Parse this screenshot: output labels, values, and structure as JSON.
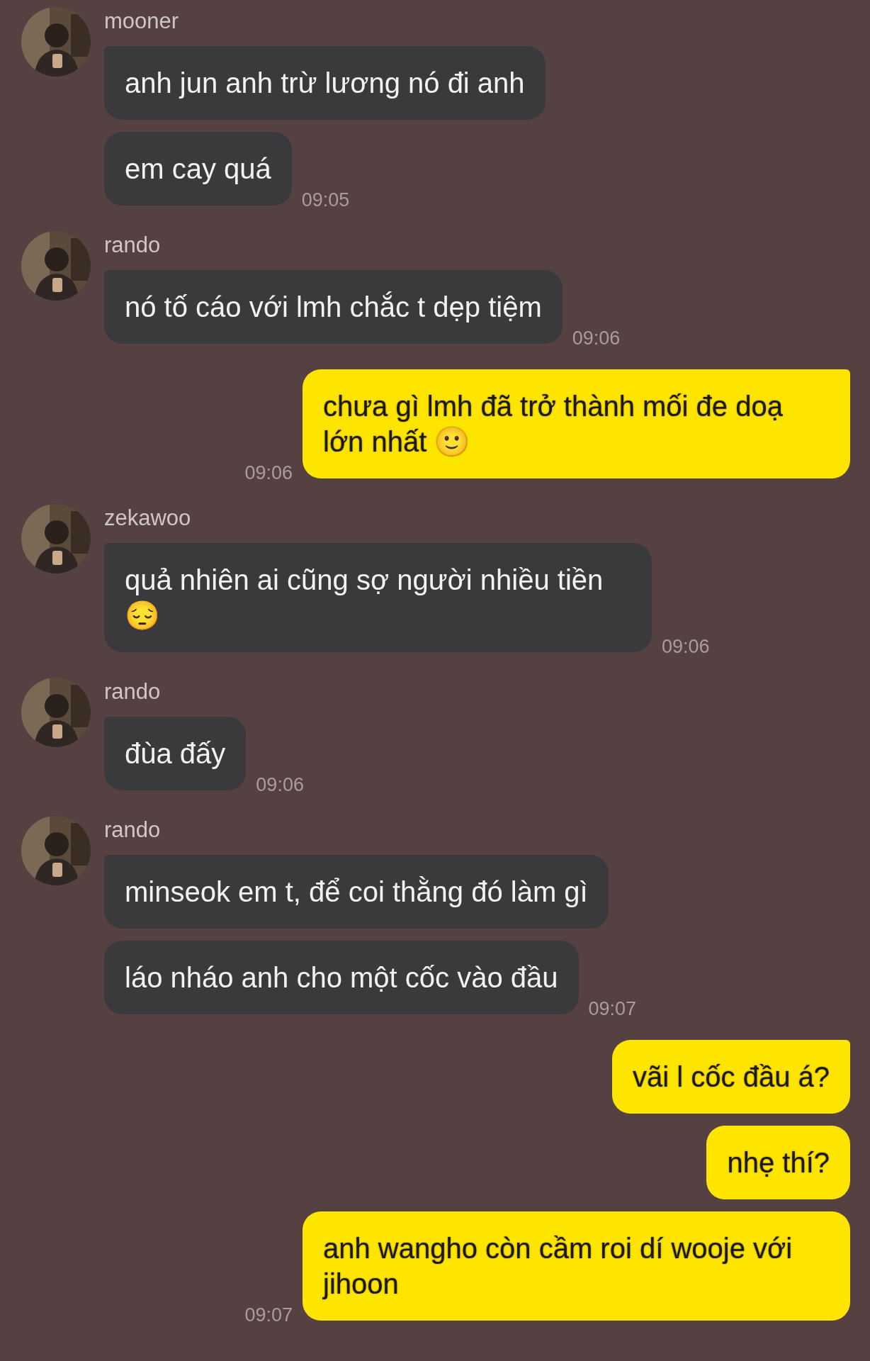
{
  "messages": [
    {
      "kind": "incoming",
      "sender": "mooner",
      "avatar": {
        "kind": "picture"
      },
      "bubbles": [
        "anh jun anh trừ lương nó đi anh",
        "em cay quá"
      ],
      "time": "09:05"
    },
    {
      "kind": "incoming",
      "sender": "rando",
      "avatar": {
        "kind": "picture"
      },
      "bubbles": [
        "nó tố cáo với lmh chắc t dẹp tiệm"
      ],
      "time": "09:06"
    },
    {
      "kind": "outgoing",
      "bubbles": [
        "chưa gì lmh đã trở thành mối đe doạ lớn nhất 🙂"
      ],
      "time": "09:06"
    },
    {
      "kind": "incoming",
      "sender": "zekawoo",
      "avatar": {
        "kind": "picture"
      },
      "bubbles": [
        "quả nhiên ai cũng sợ người nhiều tiền 😔"
      ],
      "time": "09:06"
    },
    {
      "kind": "incoming",
      "sender": "rando",
      "avatar": {
        "kind": "picture"
      },
      "bubbles": [
        "đùa đấy"
      ],
      "time": "09:06"
    },
    {
      "kind": "incoming",
      "sender": "rando",
      "avatar": {
        "kind": "picture"
      },
      "bubbles": [
        "minseok em t, để coi thằng đó làm gì",
        "láo nháo anh cho một cốc vào đầu"
      ],
      "time": "09:07"
    },
    {
      "kind": "outgoing",
      "bubbles": [
        "vãi l cốc đầu á?",
        "nhẹ thí?",
        "anh wangho còn cầm roi dí wooje với jihoon"
      ],
      "time": "09:07"
    }
  ]
}
